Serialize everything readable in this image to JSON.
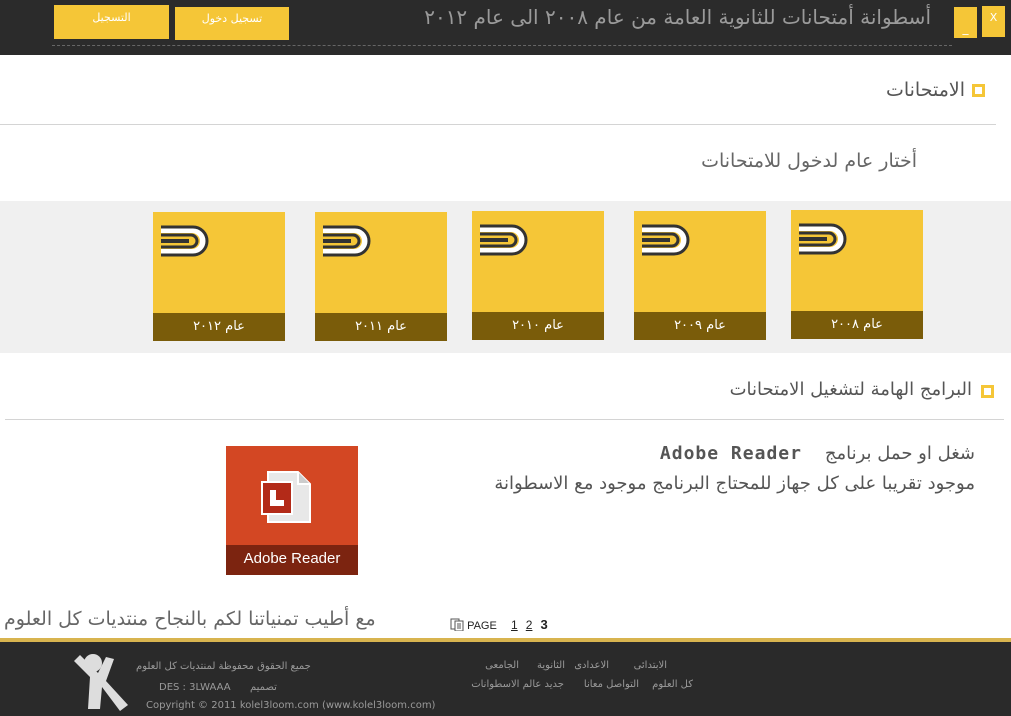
{
  "window": {
    "title": "أسطوانة أمتحانات للثانوية العامة من عام ٢٠٠٨ الى عام ٢٠١٢",
    "register_label": "التسجيل",
    "login_label": "تسجيل دخول",
    "minimize_label": "_",
    "close_label": "X"
  },
  "exams": {
    "heading": "الامتحانات",
    "prompt": "أختار عام لدخول للامتحانات",
    "years": [
      {
        "label": "عام ٢٠٠٨"
      },
      {
        "label": "عام ٢٠٠٩"
      },
      {
        "label": "عام ٢٠١٠"
      },
      {
        "label": "عام ٢٠١١"
      },
      {
        "label": "عام ٢٠١٢"
      }
    ]
  },
  "programs": {
    "heading": "البرامج الهامة لتشغيل الامتحانات",
    "line1_prefix": "شغل او حمل برنامج",
    "program_name": "Adobe Reader",
    "line2": "موجود تقريبا على كل جهاز للمحتاج البرنامج  موجود مع الاسطوانة",
    "tile_label": "Adobe Reader"
  },
  "footer_message": "مع أطيب تمنياتنا لكم بالنجاح منتديات كل العلوم",
  "pager": {
    "label": "PAGE",
    "pages": [
      "1",
      "2",
      "3"
    ],
    "current": "3"
  },
  "footer": {
    "rights": "جميع الحقوق محفوظة لمنتديات كل العلوم",
    "design_label": "تصميم",
    "designer": "DES : 3LWAAA",
    "copyright": "Copyright © 2011 kolel3loom.com (www.kolel3loom.com)",
    "links_row1": [
      "الابتدائى",
      "الاعدادى",
      "الثانوية",
      "الجامعى"
    ],
    "links_row2": [
      "كل العلوم",
      "التواصل معانا",
      "جديد عالم الاسطوانات"
    ]
  },
  "colors": {
    "accent": "#f5c637",
    "tile_band": "#7a5c0a",
    "topbar": "#2b2b2b",
    "adobe_red": "#d34723"
  }
}
